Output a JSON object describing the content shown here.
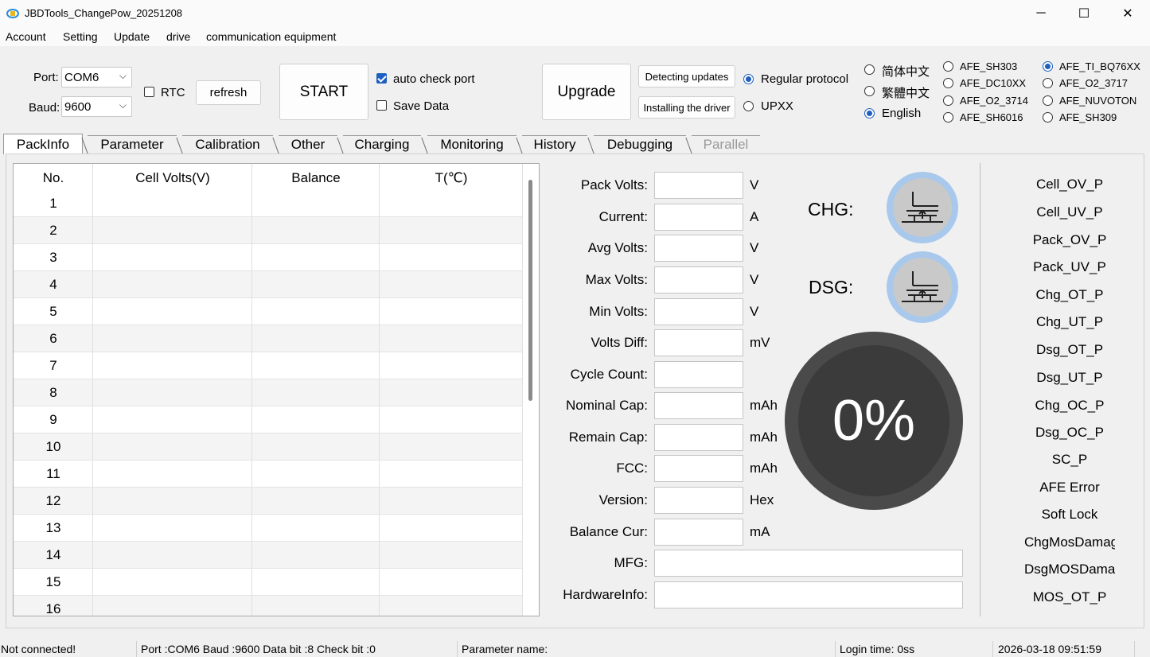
{
  "window": {
    "title": "JBDTools_ChangePow_20251208",
    "minimize": "─",
    "maximize": "☐",
    "close": "✕"
  },
  "menu": [
    "Account",
    "Setting",
    "Update",
    "drive",
    "communication equipment"
  ],
  "conn": {
    "port_label": "Port:",
    "port_value": "COM6",
    "baud_label": "Baud:",
    "baud_value": "9600",
    "rtc_label": "RTC",
    "refresh_label": "refresh",
    "start_label": "START",
    "auto_check_label": "auto check port",
    "auto_check_checked": true,
    "save_data_label": "Save Data",
    "save_data_checked": false,
    "upgrade_label": "Upgrade",
    "detect_updates_label": "Detecting updates",
    "install_driver_label": "Installing the driver",
    "protocol_regular": "Regular protocol",
    "protocol_upxx": "UPXX",
    "protocol_selected": "regular"
  },
  "languages": [
    "简体中文",
    "繁體中文",
    "English"
  ],
  "language_selected": "English",
  "afe_col1": [
    "AFE_SH303",
    "AFE_DC10XX",
    "AFE_O2_3714",
    "AFE_SH6016"
  ],
  "afe_col2": [
    "AFE_TI_BQ76XX",
    "AFE_O2_3717",
    "AFE_NUVOTON",
    "AFE_SH309"
  ],
  "afe_selected": "AFE_TI_BQ76XX",
  "tabs": [
    "PackInfo",
    "Parameter",
    "Calibration",
    "Other",
    "Charging",
    "Monitoring",
    "History",
    "Debugging",
    "Parallel"
  ],
  "table": {
    "headers": [
      "No.",
      "Cell Volts(V)",
      "Balance",
      "T(℃)"
    ],
    "rows": [
      "1",
      "2",
      "3",
      "4",
      "5",
      "6",
      "7",
      "8",
      "9",
      "10",
      "11",
      "12",
      "13",
      "14",
      "15",
      "16"
    ]
  },
  "fields": [
    {
      "label": "Pack Volts:",
      "unit": "V"
    },
    {
      "label": "Current:",
      "unit": "A"
    },
    {
      "label": "Avg Volts:",
      "unit": "V"
    },
    {
      "label": "Max Volts:",
      "unit": "V"
    },
    {
      "label": "Min Volts:",
      "unit": "V"
    },
    {
      "label": "Volts Diff:",
      "unit": "mV"
    },
    {
      "label": "Cycle Count:",
      "unit": ""
    },
    {
      "label": "Nominal Cap:",
      "unit": "mAh"
    },
    {
      "label": "Remain Cap:",
      "unit": "mAh"
    },
    {
      "label": "FCC:",
      "unit": "mAh"
    },
    {
      "label": "Version:",
      "unit": "Hex"
    },
    {
      "label": "Balance Cur:",
      "unit": "mA"
    }
  ],
  "wide_fields": [
    {
      "label": "MFG:"
    },
    {
      "label": "HardwareInfo:"
    }
  ],
  "mos": {
    "chg_label": "CHG:",
    "dsg_label": "DSG:"
  },
  "soc": {
    "text": "0%"
  },
  "protections": [
    "Cell_OV_P",
    "Cell_UV_P",
    "Pack_OV_P",
    "Pack_UV_P",
    "Chg_OT_P",
    "Chg_UT_P",
    "Dsg_OT_P",
    "Dsg_UT_P",
    "Chg_OC_P",
    "Dsg_OC_P",
    "SC_P",
    "AFE Error",
    "Soft Lock",
    "ChgMosDamage",
    "DsgMOSDamage",
    "MOS_OT_P"
  ],
  "status": {
    "connection": "Not connected!",
    "port_info": "Port :COM6 Baud :9600 Data bit :8 Check bit :0",
    "parameter": "Parameter name:",
    "login_time": "Login time: 0ss",
    "datetime": "2026-03-18 09:51:59"
  },
  "colors": {
    "accent": "#1f5fbf",
    "mos_ring": "#a8c8ec",
    "soc_ring": "#3b3b3b"
  }
}
